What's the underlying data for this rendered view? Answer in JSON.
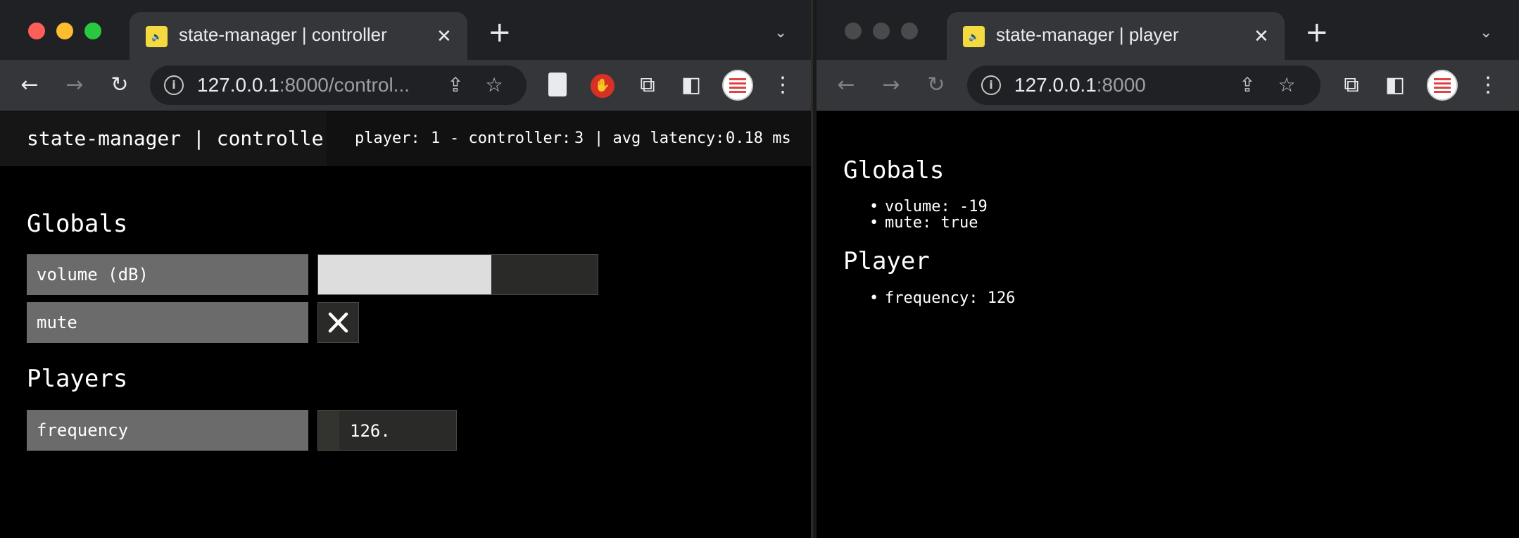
{
  "left_window": {
    "tab_title": "state-manager | controller",
    "favicon": "speaker-key-icon",
    "url_host": "127.0.0.1",
    "url_rest": ":8000/control...",
    "app": {
      "title": "state-manager | controller",
      "status": {
        "player_label": "player:",
        "player_count": "1",
        "controller_label": "- controller:",
        "controller_count": "3",
        "latency_label": "| avg latency:",
        "latency_value": "0.18 ms"
      },
      "globals": {
        "heading": "Globals",
        "volume": {
          "label": "volume (dB)",
          "value": -19,
          "fill_fraction": 0.62
        },
        "mute": {
          "label": "mute",
          "value": true,
          "icon": "x-icon"
        }
      },
      "players": {
        "heading": "Players",
        "frequency": {
          "label": "frequency",
          "display": "126."
        }
      }
    }
  },
  "right_window": {
    "tab_title": "state-manager | player",
    "url_host": "127.0.0.1",
    "url_rest": ":8000",
    "globals": {
      "heading": "Globals",
      "items": [
        "volume: -19",
        "mute: true"
      ]
    },
    "player": {
      "heading": "Player",
      "items": [
        "frequency: 126"
      ]
    }
  },
  "colors": {
    "tabstrip": "#202124",
    "toolbar": "#35363a",
    "label_bg": "#6b6b6b",
    "control_bg": "#2a2a28",
    "slider_fill": "#dddddd"
  }
}
